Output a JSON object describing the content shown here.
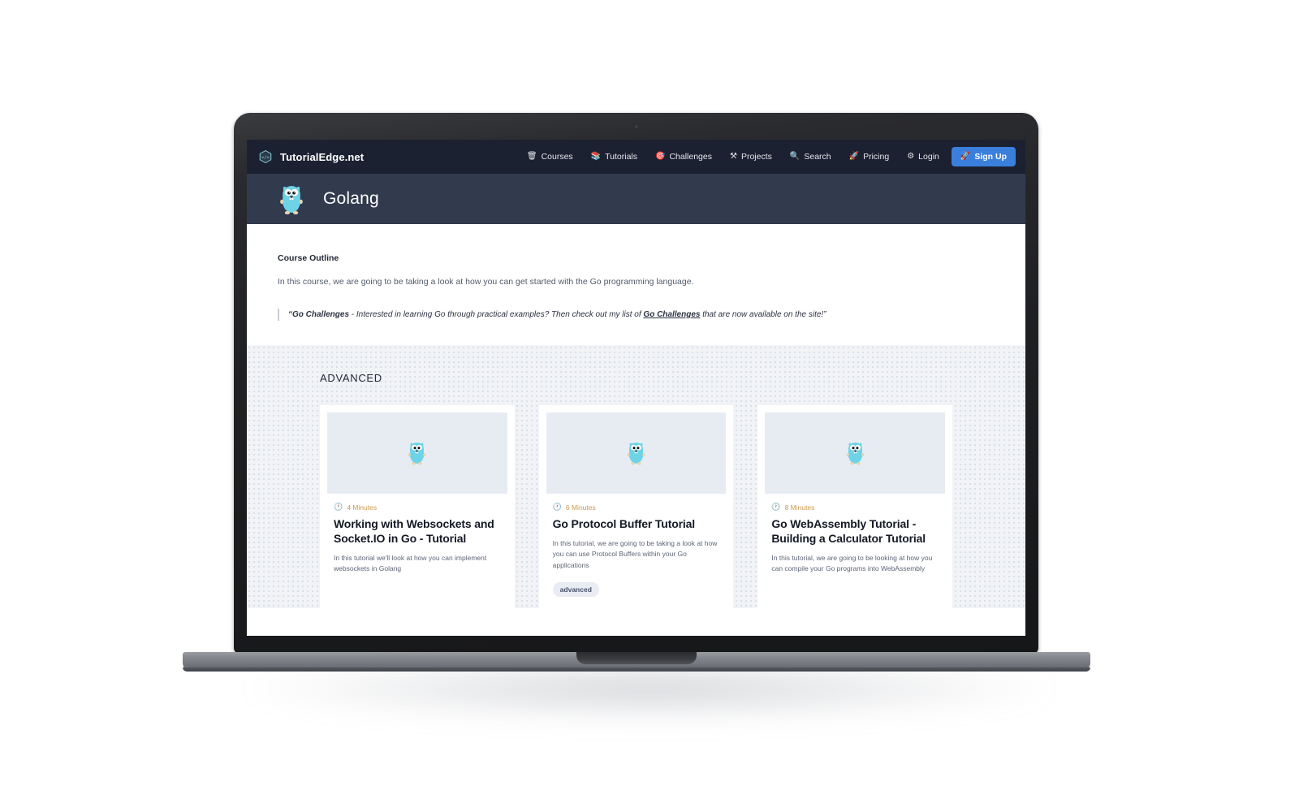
{
  "navbar": {
    "logo_icon": "hexagon-code-logo",
    "brand": "TutorialEdge.net",
    "links": [
      {
        "icon": "🗑",
        "label": "Courses"
      },
      {
        "icon": "📚",
        "label": "Tutorials"
      },
      {
        "icon": "🎯",
        "label": "Challenges"
      },
      {
        "icon": "⚒",
        "label": "Projects"
      },
      {
        "icon": "🔍",
        "label": "Search"
      },
      {
        "icon": "🚀",
        "label": "Pricing"
      },
      {
        "icon": "⚙",
        "label": "Login"
      }
    ],
    "signup": {
      "icon": "🚀",
      "label": "Sign Up"
    },
    "background": "#1b2130",
    "signup_color": "#3b7fdd"
  },
  "hero": {
    "icon": "go-gopher-mascot",
    "title": "Golang",
    "background": "#323b4e"
  },
  "outline": {
    "heading": "Course Outline",
    "description": "In this course, we are going to be taking a look at how you can get started with the Go programming language.",
    "quote_pre": "“Go Challenges",
    "quote_mid": " - Interested in learning Go through practical examples? Then check out my list of ",
    "quote_link": "Go Challenges",
    "quote_post": " that are now available on the site!”"
  },
  "advanced": {
    "heading": "ADVANCED",
    "background": "#f1f3f7",
    "cards": [
      {
        "image_icon": "go-gopher-mascot",
        "duration_icon": "🕐",
        "duration": "4 Minutes",
        "title": "Working with Websockets and Socket.IO in Go - Tutorial",
        "description": "In this tutorial we'll look at how you can implement websockets in Golang",
        "tags": []
      },
      {
        "image_icon": "go-gopher-mascot",
        "duration_icon": "🕐",
        "duration": "6 Minutes",
        "title": "Go Protocol Buffer Tutorial",
        "description": "In this tutorial, we are going to be taking a look at how you can use Protocol Buffers within your Go applications",
        "tags": [
          "advanced"
        ]
      },
      {
        "image_icon": "go-gopher-mascot",
        "duration_icon": "🕐",
        "duration": "8 Minutes",
        "title": "Go WebAssembly Tutorial - Building a Calculator Tutorial",
        "description": "In this tutorial, we are going to be looking at how you can compile your Go programs into WebAssembly",
        "tags": []
      }
    ]
  }
}
